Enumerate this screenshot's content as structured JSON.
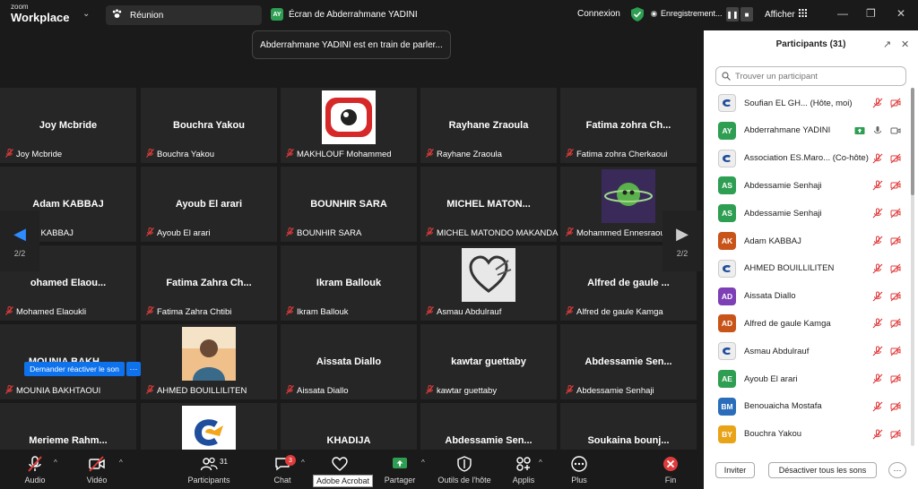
{
  "app": {
    "logo_small": "zoom",
    "logo_big": "Workplace"
  },
  "header": {
    "meeting_label": "Réunion",
    "screen_share_badge": "AY",
    "screen_share_label": "Écran de Abderrahmane YADINI",
    "connexion": "Connexion",
    "recording": "Enregistrement...",
    "afficher": "Afficher"
  },
  "toast": "Abderrahmane YADINI est en train de parler...",
  "nav": {
    "page": "2/2"
  },
  "unmute_request": "Demander réactiver le son",
  "tiles": [
    {
      "center": "Joy Mcbride",
      "foot": "Joy Mcbride"
    },
    {
      "center": "Bouchra Yakou",
      "foot": "Bouchra Yakou"
    },
    {
      "center": "",
      "foot": "MAKHLOUF Mohammed",
      "img": "red-eye"
    },
    {
      "center": "Rayhane Zraoula",
      "foot": "Rayhane Zraoula"
    },
    {
      "center": "Fatima zohra Ch...",
      "foot": "Fatima zohra Cherkaoui"
    },
    {
      "center": "Adam KABBAJ",
      "foot": "Adam KABBAJ"
    },
    {
      "center": "Ayoub El arari",
      "foot": "Ayoub El arari"
    },
    {
      "center": "BOUNHIR SARA",
      "foot": "BOUNHIR SARA"
    },
    {
      "center": "MICHEL MATON...",
      "foot": "MICHEL MATONDO MAKANDA"
    },
    {
      "center": "",
      "foot": "Mohammed Ennesraoui",
      "img": "planet"
    },
    {
      "center": "ohamed Elaou...",
      "foot": "Mohamed Elaoukli"
    },
    {
      "center": "Fatima Zahra Ch...",
      "foot": "Fatima Zahra Chtibi"
    },
    {
      "center": "Ikram Ballouk",
      "foot": "Ikram Ballouk"
    },
    {
      "center": "",
      "foot": "Asmau Abdulrauf",
      "img": "heart"
    },
    {
      "center": "Alfred de gaule ...",
      "foot": "Alfred de gaule Kamga"
    },
    {
      "center": "MOUNIA BAKH...",
      "foot": "MOUNIA BAKHTAOUI"
    },
    {
      "center": "",
      "foot": "AHMED BOUILLILITEN",
      "img": "photo"
    },
    {
      "center": "Aissata Diallo",
      "foot": "Aissata Diallo"
    },
    {
      "center": "kawtar guettaby",
      "foot": "kawtar guettaby"
    },
    {
      "center": "Abdessamie Sen...",
      "foot": "Abdessamie Senhaji"
    },
    {
      "center": "Merieme Rahm...",
      "foot": "Merieme Rahmouni"
    },
    {
      "center": "",
      "foot": "Association ES.Maroc.Org",
      "img": "logo"
    },
    {
      "center": "KHADIJA",
      "foot": "KHADIJA"
    },
    {
      "center": "Abdessamie Sen...",
      "foot": "Abdessamie Senhaji"
    },
    {
      "center": "Soukaina bounj...",
      "foot": "Soukaina bounjoum"
    }
  ],
  "toolbar": {
    "audio": "Audio",
    "video": "Vidéo",
    "participants": "Participants",
    "participants_count": "31",
    "chat": "Chat",
    "chat_badge": "3",
    "share": "Partager",
    "host_tools": "Outils de l'hôte",
    "apps": "Applis",
    "more": "Plus",
    "end": "Fin",
    "tooltip": "Adobe Acrobat"
  },
  "panel": {
    "title": "Participants (31)",
    "search_placeholder": "Trouver un participant",
    "invite": "Inviter",
    "mute_all": "Désactiver tous les sons",
    "participants": [
      {
        "initials": "",
        "name": "Soufian EL GH... (Hôte, moi)",
        "color": "#ffffff",
        "img": true
      },
      {
        "initials": "AY",
        "name": "Abderrahmane YADINI",
        "color": "#2e9e52",
        "img": false,
        "sharing": true
      },
      {
        "initials": "",
        "name": "Association ES.Maro... (Co-hôte)",
        "color": "#ffffff",
        "img": true
      },
      {
        "initials": "AS",
        "name": "Abdessamie Senhaji",
        "color": "#2e9e52",
        "img": false
      },
      {
        "initials": "AS",
        "name": "Abdessamie Senhaji",
        "color": "#2e9e52",
        "img": false
      },
      {
        "initials": "AK",
        "name": "Adam KABBAJ",
        "color": "#c9541a",
        "img": false
      },
      {
        "initials": "",
        "name": "AHMED BOUILLILITEN",
        "color": "#ffffff",
        "img": true
      },
      {
        "initials": "AD",
        "name": "Aissata Diallo",
        "color": "#7d3fb5",
        "img": false
      },
      {
        "initials": "AD",
        "name": "Alfred de gaule Kamga",
        "color": "#c9541a",
        "img": false
      },
      {
        "initials": "",
        "name": "Asmau Abdulrauf",
        "color": "#ffffff",
        "img": true
      },
      {
        "initials": "AE",
        "name": "Ayoub El arari",
        "color": "#2e9e52",
        "img": false
      },
      {
        "initials": "BM",
        "name": "Benouaicha Mostafa",
        "color": "#2a6ebb",
        "img": false
      },
      {
        "initials": "BY",
        "name": "Bouchra Yakou",
        "color": "#e8a317",
        "img": false
      }
    ]
  }
}
